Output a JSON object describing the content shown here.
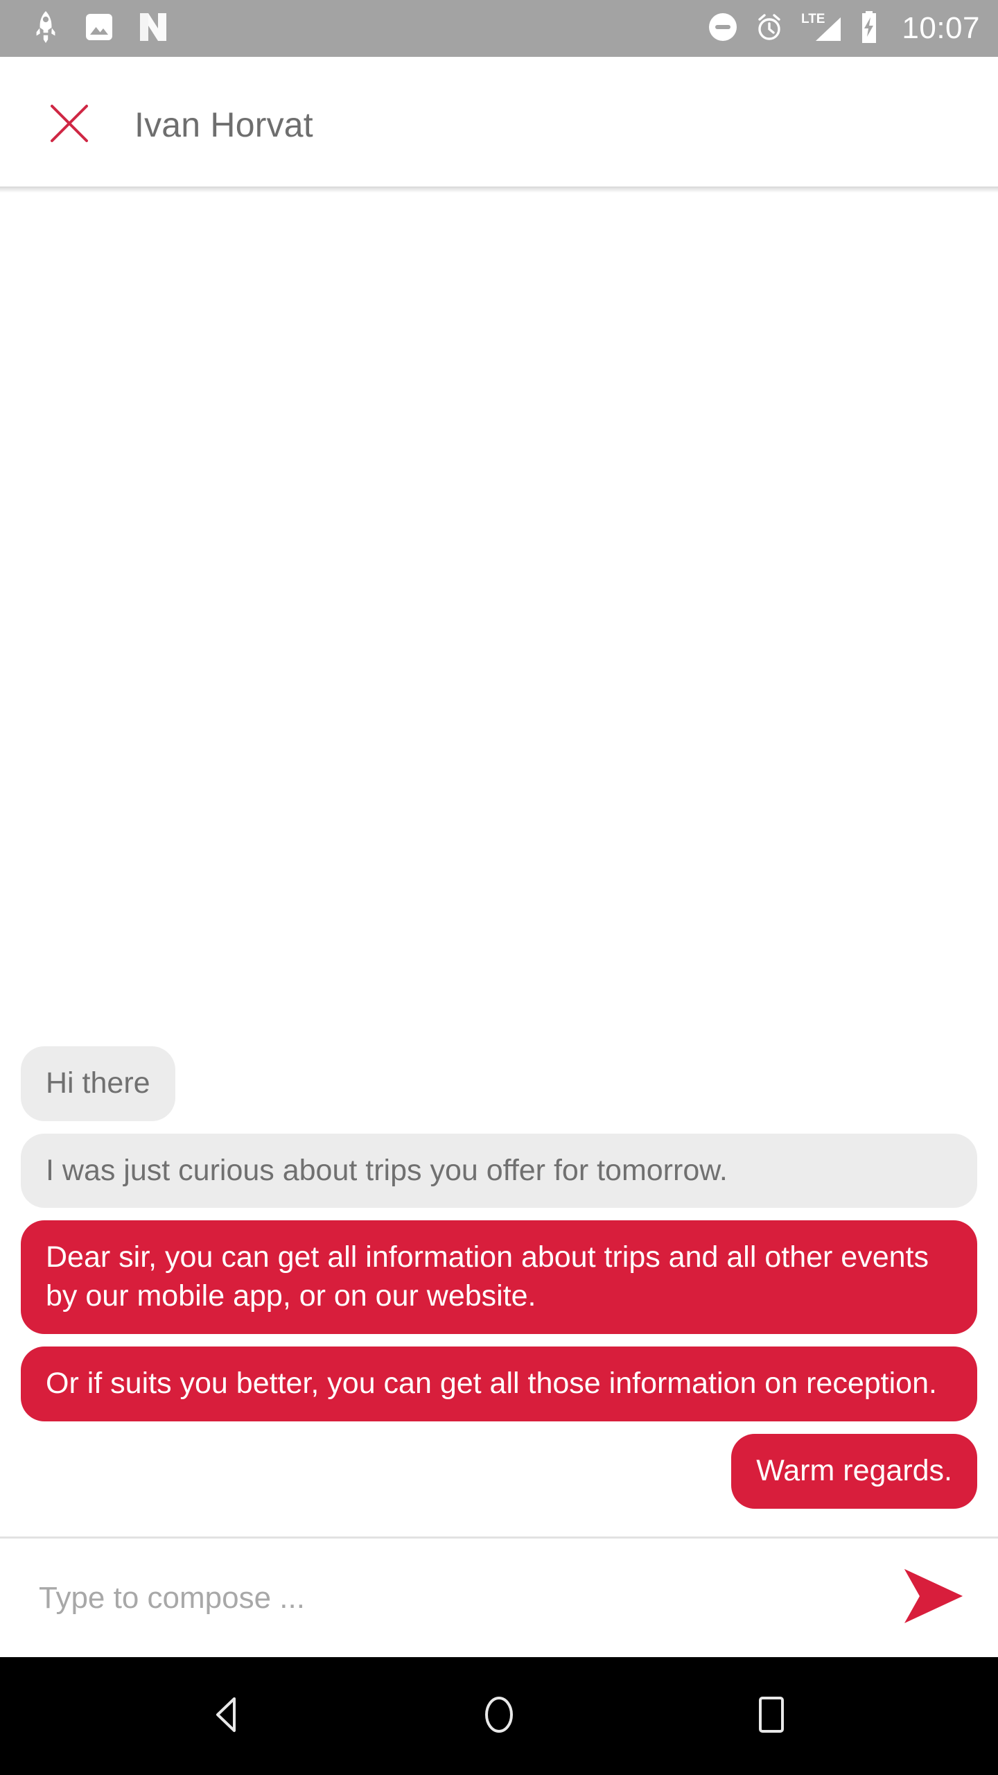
{
  "status_bar": {
    "left_icons": [
      "rocket-icon",
      "photo-icon",
      "android-n-icon"
    ],
    "right_icons": [
      "do-not-disturb-icon",
      "alarm-icon",
      "lte-signal-icon",
      "battery-charging-icon"
    ],
    "network_label": "LTE",
    "clock": "10:07",
    "background_color": "#a3a3a3"
  },
  "app_bar": {
    "close_icon": "close-icon",
    "title": "Ivan Horvat"
  },
  "conversation": {
    "messages": [
      {
        "direction": "incoming",
        "text": "Hi there",
        "wide": false
      },
      {
        "direction": "incoming",
        "text": "I was just curious about trips you offer for tomorrow.",
        "wide": true
      },
      {
        "direction": "outgoing",
        "text": "Dear sir, you can get all information about trips and all other events by our mobile app, or on our website.",
        "wide": true
      },
      {
        "direction": "outgoing",
        "text": "Or if suits you better, you can get all those information on reception.",
        "wide": true
      },
      {
        "direction": "outgoing",
        "text": "Warm regards.",
        "wide": false
      }
    ]
  },
  "compose": {
    "placeholder": "Type to compose ...",
    "value": "",
    "send_icon": "send-icon"
  },
  "nav_bar": {
    "back_label": "back-icon",
    "home_label": "home-icon",
    "recents_label": "recents-icon"
  },
  "colors": {
    "accent_red": "#d81e3c",
    "incoming_bubble": "#ececec",
    "incoming_text": "#707070",
    "outgoing_text": "#ffffff",
    "title_text": "#6e6e6e",
    "status_bar": "#a3a3a3",
    "nav_bar": "#000000"
  }
}
